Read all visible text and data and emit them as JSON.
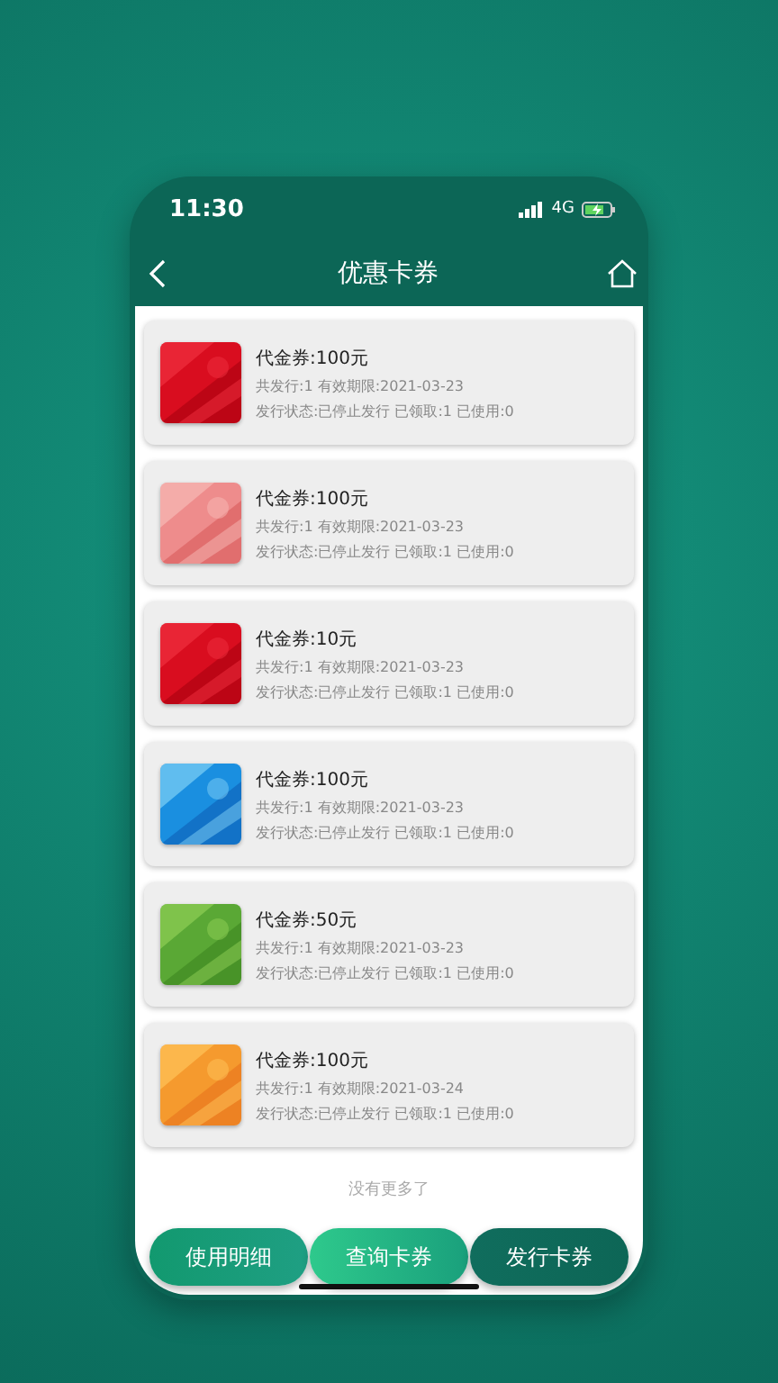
{
  "status_bar": {
    "time": "11:30",
    "network": "4G"
  },
  "header": {
    "title": "优惠卡券"
  },
  "coupons": [
    {
      "name": "代金券:100元",
      "issue": "共发行:1 有效期限:2021-03-23",
      "status": "发行状态:已停止发行  已领取:1  已使用:0"
    },
    {
      "name": "代金券:100元",
      "issue": "共发行:1 有效期限:2021-03-23",
      "status": "发行状态:已停止发行  已领取:1  已使用:0"
    },
    {
      "name": "代金券:10元",
      "issue": "共发行:1 有效期限:2021-03-23",
      "status": "发行状态:已停止发行  已领取:1  已使用:0"
    },
    {
      "name": "代金券:100元",
      "issue": "共发行:1 有效期限:2021-03-23",
      "status": "发行状态:已停止发行  已领取:1  已使用:0"
    },
    {
      "name": "代金券:50元",
      "issue": "共发行:1 有效期限:2021-03-23",
      "status": "发行状态:已停止发行  已领取:1  已使用:0"
    },
    {
      "name": "代金券:100元",
      "issue": "共发行:1 有效期限:2021-03-24",
      "status": "发行状态:已停止发行  已领取:1  已使用:0"
    }
  ],
  "list_end": "没有更多了",
  "buttons": [
    {
      "label": "使用明细",
      "selected": false
    },
    {
      "label": "查询卡券",
      "selected": true
    },
    {
      "label": "发行卡券",
      "selected": false
    }
  ]
}
